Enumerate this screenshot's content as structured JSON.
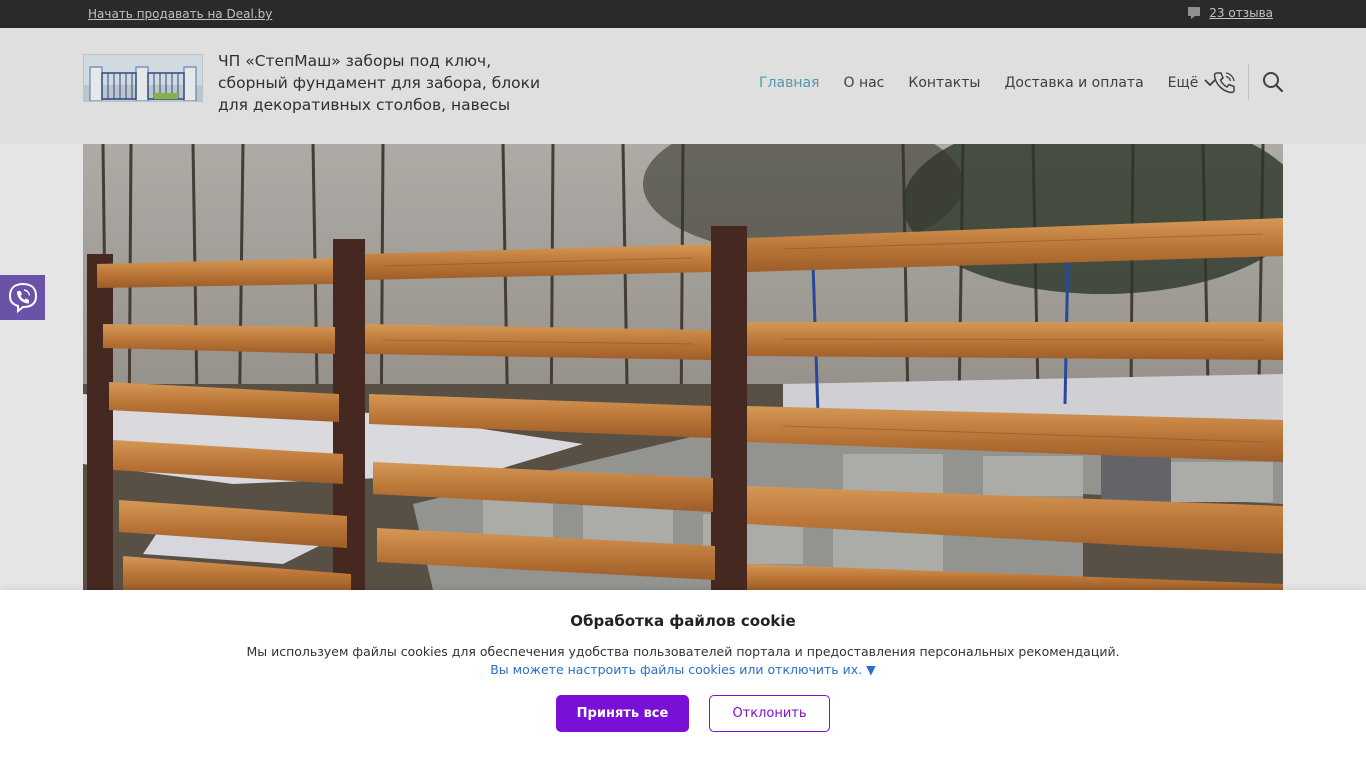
{
  "topbar": {
    "sell_link": "Начать продавать на Deal.by",
    "reviews_count": "23 отзыва"
  },
  "header": {
    "site_title": "ЧП «СтепМаш» заборы под ключ, сборный фундамент для забора, блоки для декоративных столбов, навесы",
    "nav": [
      {
        "label": "Главная",
        "active": true
      },
      {
        "label": "О нас"
      },
      {
        "label": "Контакты"
      },
      {
        "label": "Доставка и оплата"
      },
      {
        "label": "Ещё"
      }
    ]
  },
  "cookie": {
    "title": "Обработка файлов cookie",
    "text": "Мы используем файлы cookies для обеспечения удобства пользователей портала и предоставления персональных рекомендаций.",
    "settings_link": "Вы можете настроить файлы cookies или отключить их.",
    "accept_label": "Принять все",
    "decline_label": "Отклонить"
  },
  "colors": {
    "accent": "#7a0fd6",
    "nav_active": "#5aa3b5",
    "viber": "#6a52a8",
    "topbar": "#2d2d2d"
  }
}
